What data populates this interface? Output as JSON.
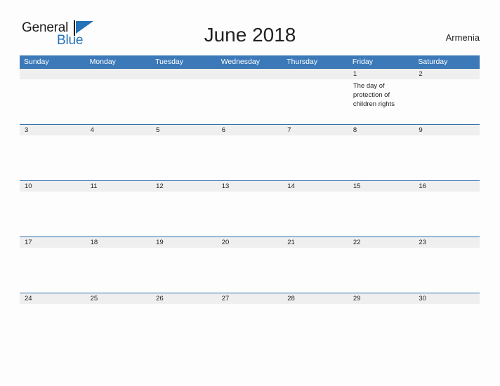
{
  "brand": {
    "name_part1": "General",
    "name_part2": "Blue",
    "flag_icon": "flag-triangle-icon",
    "color_primary": "#2572b8"
  },
  "header": {
    "title": "June 2018",
    "country": "Armenia"
  },
  "theme": {
    "header_blue": "#3b79b8",
    "row_border_blue": "#2f6ead",
    "date_band_gray": "#efefef",
    "page_background": "#fdfdfd",
    "text_dark": "#1f1f1f"
  },
  "calendar": {
    "weekdays": [
      "Sunday",
      "Monday",
      "Tuesday",
      "Wednesday",
      "Thursday",
      "Friday",
      "Saturday"
    ],
    "weeks": [
      {
        "days": [
          {
            "date": "",
            "event": ""
          },
          {
            "date": "",
            "event": ""
          },
          {
            "date": "",
            "event": ""
          },
          {
            "date": "",
            "event": ""
          },
          {
            "date": "",
            "event": ""
          },
          {
            "date": "1",
            "event": "The day of protection of children rights"
          },
          {
            "date": "2",
            "event": ""
          }
        ]
      },
      {
        "days": [
          {
            "date": "3",
            "event": ""
          },
          {
            "date": "4",
            "event": ""
          },
          {
            "date": "5",
            "event": ""
          },
          {
            "date": "6",
            "event": ""
          },
          {
            "date": "7",
            "event": ""
          },
          {
            "date": "8",
            "event": ""
          },
          {
            "date": "9",
            "event": ""
          }
        ]
      },
      {
        "days": [
          {
            "date": "10",
            "event": ""
          },
          {
            "date": "11",
            "event": ""
          },
          {
            "date": "12",
            "event": ""
          },
          {
            "date": "13",
            "event": ""
          },
          {
            "date": "14",
            "event": ""
          },
          {
            "date": "15",
            "event": ""
          },
          {
            "date": "16",
            "event": ""
          }
        ]
      },
      {
        "days": [
          {
            "date": "17",
            "event": ""
          },
          {
            "date": "18",
            "event": ""
          },
          {
            "date": "19",
            "event": ""
          },
          {
            "date": "20",
            "event": ""
          },
          {
            "date": "21",
            "event": ""
          },
          {
            "date": "22",
            "event": ""
          },
          {
            "date": "23",
            "event": ""
          }
        ]
      },
      {
        "days": [
          {
            "date": "24",
            "event": ""
          },
          {
            "date": "25",
            "event": ""
          },
          {
            "date": "26",
            "event": ""
          },
          {
            "date": "27",
            "event": ""
          },
          {
            "date": "28",
            "event": ""
          },
          {
            "date": "29",
            "event": ""
          },
          {
            "date": "30",
            "event": ""
          }
        ]
      }
    ]
  }
}
